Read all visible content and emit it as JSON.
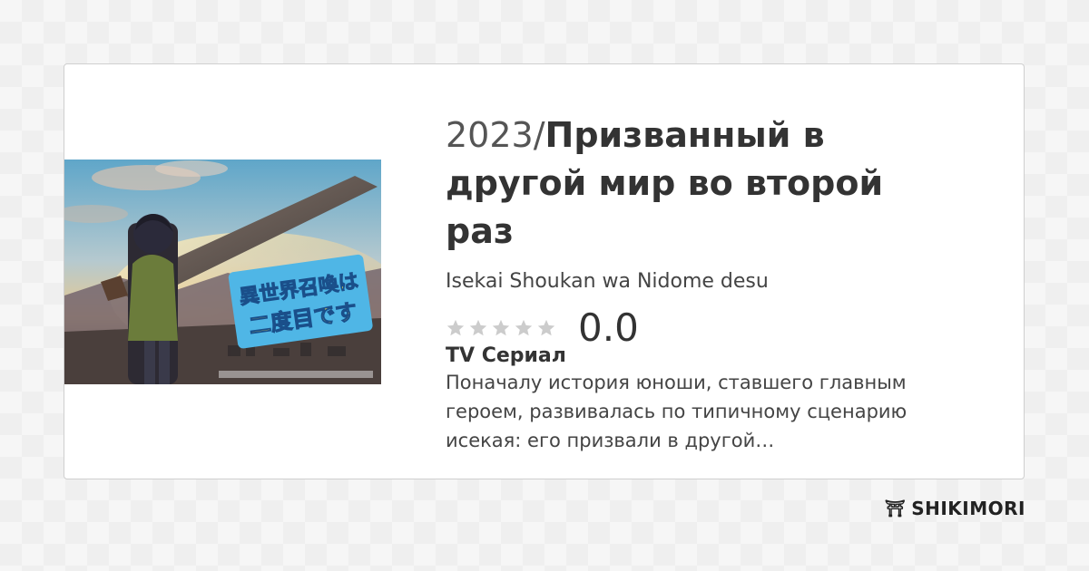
{
  "anime": {
    "year": "2023/",
    "title_ru": "Призванный в другой мир во второй раз",
    "title_romaji": "Isekai Shoukan wa Nidome desu",
    "score": "0.0",
    "stars_filled": 0,
    "stars_total": 5,
    "kind": "TV Сериал",
    "description": "Поначалу история юноши, ставшего главным героем, развивалась по типичному сценарию исекая: его призвали в другой…"
  },
  "poster": {
    "logo_line1": "異世界召喚は",
    "logo_line2": "二度目です"
  },
  "brand": {
    "icon": "shrine-gate-icon",
    "icon_glyph": "⛩",
    "name": "SHIKIMORI"
  },
  "colors": {
    "star_empty": "#cccccc",
    "text_main": "#333333"
  }
}
